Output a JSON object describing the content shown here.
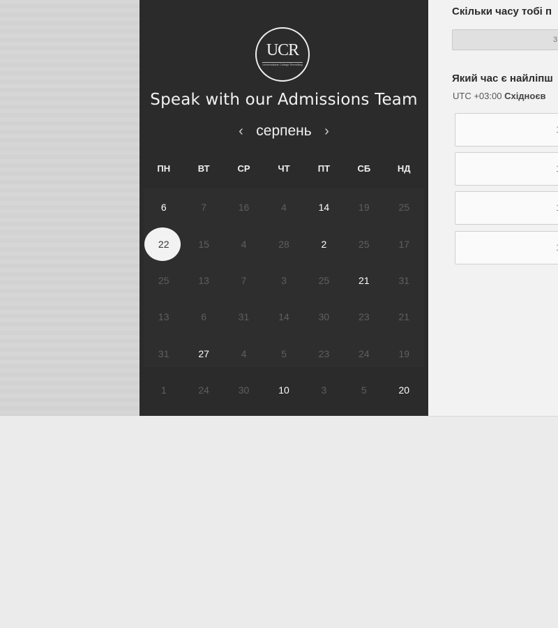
{
  "logo": {
    "text": "UCR",
    "sub": "Universidade College Recruiting"
  },
  "heading": "Speak with our Admissions Team",
  "calendar": {
    "month": "серпень",
    "weekdays": [
      "ПН",
      "ВТ",
      "СР",
      "ЧТ",
      "ПТ",
      "СБ",
      "НД"
    ],
    "weeks": [
      [
        {
          "d": "6",
          "a": true
        },
        {
          "d": "7",
          "a": false
        },
        {
          "d": "16",
          "a": false
        },
        {
          "d": "4",
          "a": false
        },
        {
          "d": "14",
          "a": true
        },
        {
          "d": "19",
          "a": false
        },
        {
          "d": "25",
          "a": false
        }
      ],
      [
        {
          "d": "22",
          "a": true,
          "s": true
        },
        {
          "d": "15",
          "a": false
        },
        {
          "d": "4",
          "a": false
        },
        {
          "d": "28",
          "a": false
        },
        {
          "d": "2",
          "a": true
        },
        {
          "d": "25",
          "a": false
        },
        {
          "d": "17",
          "a": false
        }
      ],
      [
        {
          "d": "25",
          "a": false
        },
        {
          "d": "13",
          "a": false
        },
        {
          "d": "7",
          "a": false
        },
        {
          "d": "3",
          "a": false
        },
        {
          "d": "25",
          "a": false
        },
        {
          "d": "21",
          "a": true
        },
        {
          "d": "31",
          "a": false
        }
      ],
      [
        {
          "d": "13",
          "a": false
        },
        {
          "d": "6",
          "a": false
        },
        {
          "d": "31",
          "a": false
        },
        {
          "d": "14",
          "a": false
        },
        {
          "d": "30",
          "a": false
        },
        {
          "d": "23",
          "a": false
        },
        {
          "d": "21",
          "a": false
        }
      ],
      [
        {
          "d": "31",
          "a": false
        },
        {
          "d": "27",
          "a": true
        },
        {
          "d": "4",
          "a": false
        },
        {
          "d": "5",
          "a": false
        },
        {
          "d": "23",
          "a": false
        },
        {
          "d": "24",
          "a": false
        },
        {
          "d": "19",
          "a": false
        }
      ],
      [
        {
          "d": "1",
          "a": false
        },
        {
          "d": "24",
          "a": false
        },
        {
          "d": "30",
          "a": false
        },
        {
          "d": "10",
          "a": true
        },
        {
          "d": "3",
          "a": false
        },
        {
          "d": "5",
          "a": false
        },
        {
          "d": "20",
          "a": true
        }
      ]
    ]
  },
  "booking": {
    "duration_question": "Скільки часу тобі п",
    "duration_value": "3",
    "time_question": "Який час є найліпш",
    "timezone_offset": "UTC +03:00",
    "timezone_name": "Східноєв",
    "slots": [
      "1",
      "1",
      "1",
      "1"
    ]
  },
  "colors": {
    "panel_dark": "#2b2b2b",
    "selected_day": "#f2f2f2",
    "page_bg": "#ebebeb"
  }
}
